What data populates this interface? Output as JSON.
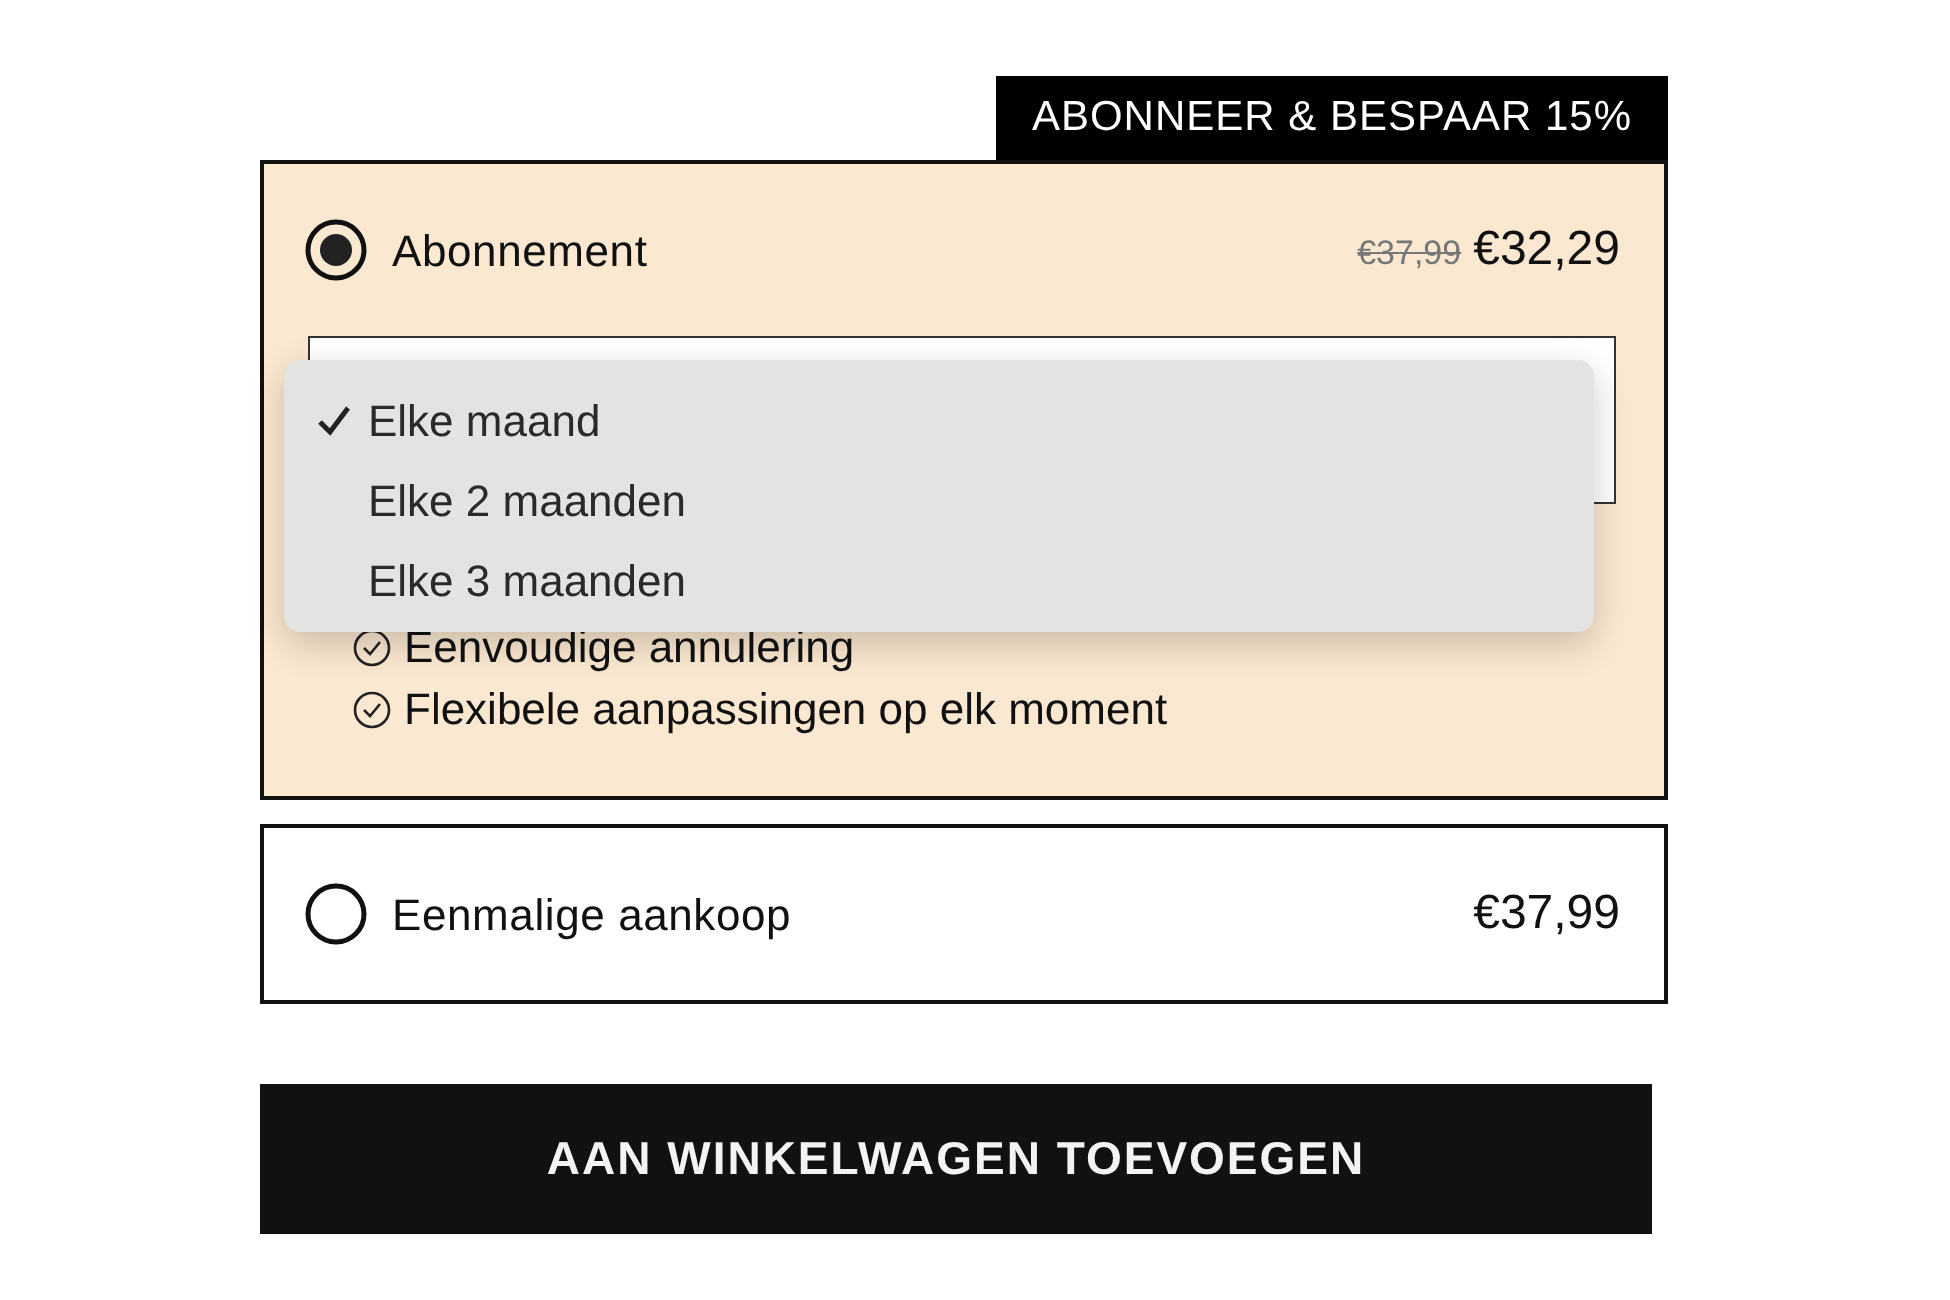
{
  "badge": "ABONNEER & BESPAAR 15%",
  "plans": [
    {
      "label": "Abonnement",
      "selected": true,
      "old_price": "€37,99",
      "price": "€32,29",
      "frequency_options": [
        {
          "label": "Elke maand",
          "selected": true
        },
        {
          "label": "Elke 2 maanden",
          "selected": false
        },
        {
          "label": "Elke 3 maanden",
          "selected": false
        }
      ],
      "benefits": [
        "Eenvoudige annulering",
        "Flexibele aanpassingen op elk moment"
      ]
    },
    {
      "label": "Eenmalige aankoop",
      "selected": false,
      "price": "€37,99"
    }
  ],
  "button": "AAN WINKELWAGEN TOEVOEGEN"
}
